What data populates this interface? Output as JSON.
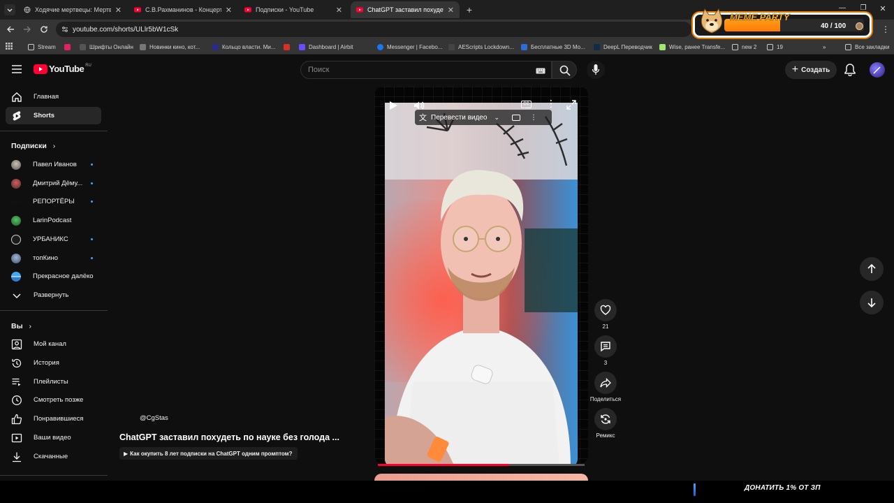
{
  "browser": {
    "tabs": [
      {
        "title": "Ходячие мертвецы: Мертвый",
        "active": false
      },
      {
        "title": "С.В.Рахманинов - Концерт №",
        "active": false
      },
      {
        "title": "Подписки - YouTube",
        "active": false
      },
      {
        "title": "ChatGPT заставил похудеть по",
        "active": true
      }
    ],
    "url": "youtube.com/shorts/ULlr5bW1cSk",
    "bookmarks": [
      "Stream",
      "Шрифты Онлайн",
      "Новинки кино, кот...",
      "Кольцо власти. Ми...",
      "Dashboard | Airbit",
      "Messenger | Facebo...",
      "AEScripts Lockdown...",
      "Бесплатные 3D Мо...",
      "DeepL Переводчик",
      "Wise, ранее Transfe...",
      "new 2",
      "19",
      "Все закладки"
    ]
  },
  "overlay": {
    "meme_brand": "MEME PARTY",
    "progress_text": "40 / 100",
    "progress_value": 0.4,
    "donate_text": "ДОНАТИТЬ 1% ОТ ЗП"
  },
  "youtube": {
    "logo": "YouTube",
    "logo_region": "RU",
    "search_placeholder": "Поиск",
    "create_label": "Создать",
    "sidebar": {
      "main": [
        {
          "label": "Главная",
          "icon": "home-icon",
          "active": false
        },
        {
          "label": "Shorts",
          "icon": "shorts-icon",
          "active": true
        }
      ],
      "subs_header": "Подписки",
      "subscriptions": [
        {
          "label": "Павел Иванов",
          "new": true
        },
        {
          "label": "Дмитрий Дёму...",
          "new": true
        },
        {
          "label": "РЕПОРТЁРЫ",
          "new": true
        },
        {
          "label": "LarinPodcast",
          "new": false
        },
        {
          "label": "УРБАНИКС",
          "new": true
        },
        {
          "label": "топКино",
          "new": true
        },
        {
          "label": "Прекрасное далёко",
          "new": false
        }
      ],
      "expand_label": "Развернуть",
      "you_header": "Вы",
      "you_items": [
        {
          "label": "Мой канал",
          "icon": "account-icon"
        },
        {
          "label": "История",
          "icon": "history-icon"
        },
        {
          "label": "Плейлисты",
          "icon": "playlists-icon"
        },
        {
          "label": "Смотреть позже",
          "icon": "watch-later-icon"
        },
        {
          "label": "Понравившиеся",
          "icon": "liked-icon"
        },
        {
          "label": "Ваши видео",
          "icon": "your-videos-icon"
        },
        {
          "label": "Скачанные",
          "icon": "downloads-icon"
        }
      ]
    },
    "short": {
      "channel": "@CgStas",
      "title": "ChatGPT заставил похудеть по науке без голода ...",
      "related_link": "Как окупить 8 лет подписки на ChatGPT одним промптом?",
      "translate_label": "Перевести видео",
      "likes": "21",
      "comments": "3",
      "share_label": "Поделиться",
      "remix_label": "Ремикс"
    }
  }
}
